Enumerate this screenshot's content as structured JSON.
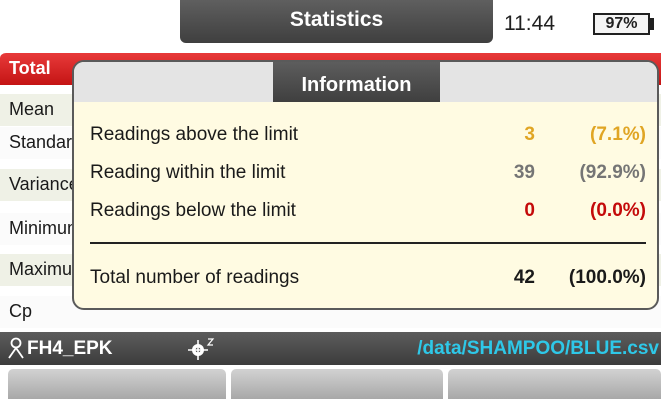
{
  "header": {
    "title": "Statistics",
    "time": "11:44",
    "battery": "97%"
  },
  "stats_list": {
    "items": [
      {
        "label": "Total",
        "active": true
      },
      {
        "label": "Mean"
      },
      {
        "label": "Standard deviation"
      },
      {
        "label": "Variance"
      },
      {
        "label": "Minimum"
      },
      {
        "label": "Maximum"
      },
      {
        "label": "Cp"
      }
    ]
  },
  "dialog": {
    "title": "Information",
    "rows": [
      {
        "label": "Readings above the limit",
        "count": "3",
        "percent": "(7.1%)",
        "status_color": "#e0a524"
      },
      {
        "label": "Reading within the limit",
        "count": "39",
        "percent": "(92.9%)",
        "status_color": "#757575"
      },
      {
        "label": "Readings below the limit",
        "count": "0",
        "percent": "(0.0%)",
        "status_color": "#c40a0a"
      }
    ],
    "total": {
      "label": "Total number of readings",
      "count": "42",
      "percent": "(100.0%)"
    }
  },
  "status_bar": {
    "probe_icon": "probe-icon",
    "probe_name": "FH4_EPK",
    "target_icon": "crosshair-z-icon",
    "file_path": "/data/SHAMPOO/BLUE.csv"
  },
  "softkeys": [
    "",
    "",
    ""
  ],
  "colors": {
    "accent_red": "#d42020",
    "title_bar": "#4a4a4a",
    "path_cyan": "#2ec8e8",
    "dialog_bg": "#fffbe2"
  }
}
